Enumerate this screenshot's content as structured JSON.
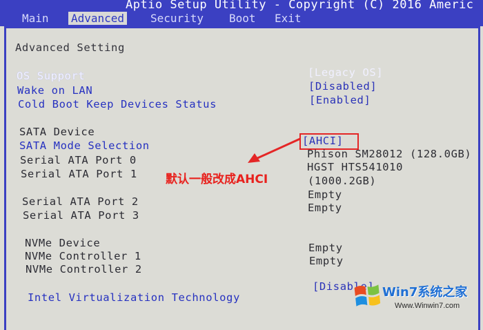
{
  "header": {
    "title": "Aptio Setup Utility - Copyright (C) 2016 Americ",
    "tabs": [
      {
        "label": "Main"
      },
      {
        "label": "Advanced"
      },
      {
        "label": "Security"
      },
      {
        "label": "Boot"
      },
      {
        "label": "Exit"
      }
    ]
  },
  "main": {
    "section_title": "Advanced Setting",
    "os_support": {
      "label": "OS Support",
      "value": "[Legacy OS]"
    },
    "wake_on_lan": {
      "label": "Wake on LAN",
      "value": "[Disabled]"
    },
    "cold_boot": {
      "label": "Cold Boot Keep Devices Status",
      "value": "[Enabled]"
    },
    "sata_device": "SATA Device",
    "sata_mode": {
      "label": "SATA Mode Selection",
      "value": "[AHCI]"
    },
    "ports": [
      {
        "label": "Serial ATA Port 0",
        "value": "Phison SM28012 (128.0GB)"
      },
      {
        "label": "Serial ATA Port 1",
        "value": "HGST HTS541010",
        "value2": "(1000.2GB)"
      },
      {
        "label": "Serial ATA Port 2",
        "value": "Empty"
      },
      {
        "label": "Serial ATA Port 3",
        "value": "Empty"
      }
    ],
    "nvme_device": "NVMe Device",
    "nvme_controllers": [
      {
        "label": "NVMe Controller 1",
        "value": "Empty"
      },
      {
        "label": "NVMe Controller 2",
        "value": "Empty"
      }
    ],
    "virtualization": {
      "label": "Intel Virtualization Technology",
      "value": "[Disable]"
    }
  },
  "annotation": {
    "text": "默认一般改成AHCI",
    "color": "#e8211d"
  },
  "watermark": {
    "top": "Win7系统之家",
    "bottom": "Www.Winwin7.com"
  },
  "colors": {
    "header_bg": "#3b40c2",
    "panel_bg": "#dcdcd6",
    "link": "#2631c0"
  }
}
